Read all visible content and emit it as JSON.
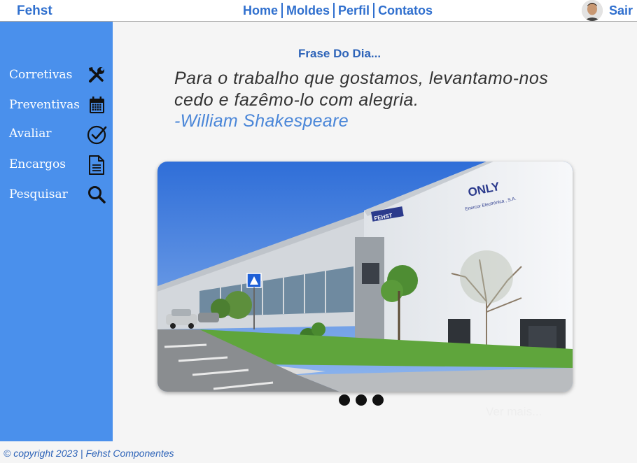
{
  "header": {
    "brand": "Fehst",
    "nav": [
      "Home",
      "Moldes",
      "Perfil",
      "Contatos"
    ],
    "logout_label": "Sair"
  },
  "sidebar": {
    "items": [
      {
        "label": "Corretivas",
        "icon": "tools-icon"
      },
      {
        "label": "Preventivas",
        "icon": "calendar-icon"
      },
      {
        "label": "Avaliar",
        "icon": "check-circle-icon"
      },
      {
        "label": "Encargos",
        "icon": "document-icon"
      },
      {
        "label": "Pesquisar",
        "icon": "search-icon"
      }
    ]
  },
  "main": {
    "quote_title": "Frase Do Dia...",
    "quote_text": "Para o trabalho que gostamos, levantamo-nos cedo e fazêmo-lo com alegria.",
    "quote_author": "-William Shakespeare",
    "carousel": {
      "sign_brand": "ONLY",
      "sign_subtitle": "Enercor Electrónica , S.A.",
      "building_label": "FEHST",
      "dots": 3
    },
    "ver_mais": "Ver mais..."
  },
  "footer": {
    "copyright": "© copyright 2023 | Fehst Componentes"
  },
  "colors": {
    "accent": "#2f6fce",
    "sidebar": "#4a90ec",
    "background": "#f5f5f5"
  }
}
